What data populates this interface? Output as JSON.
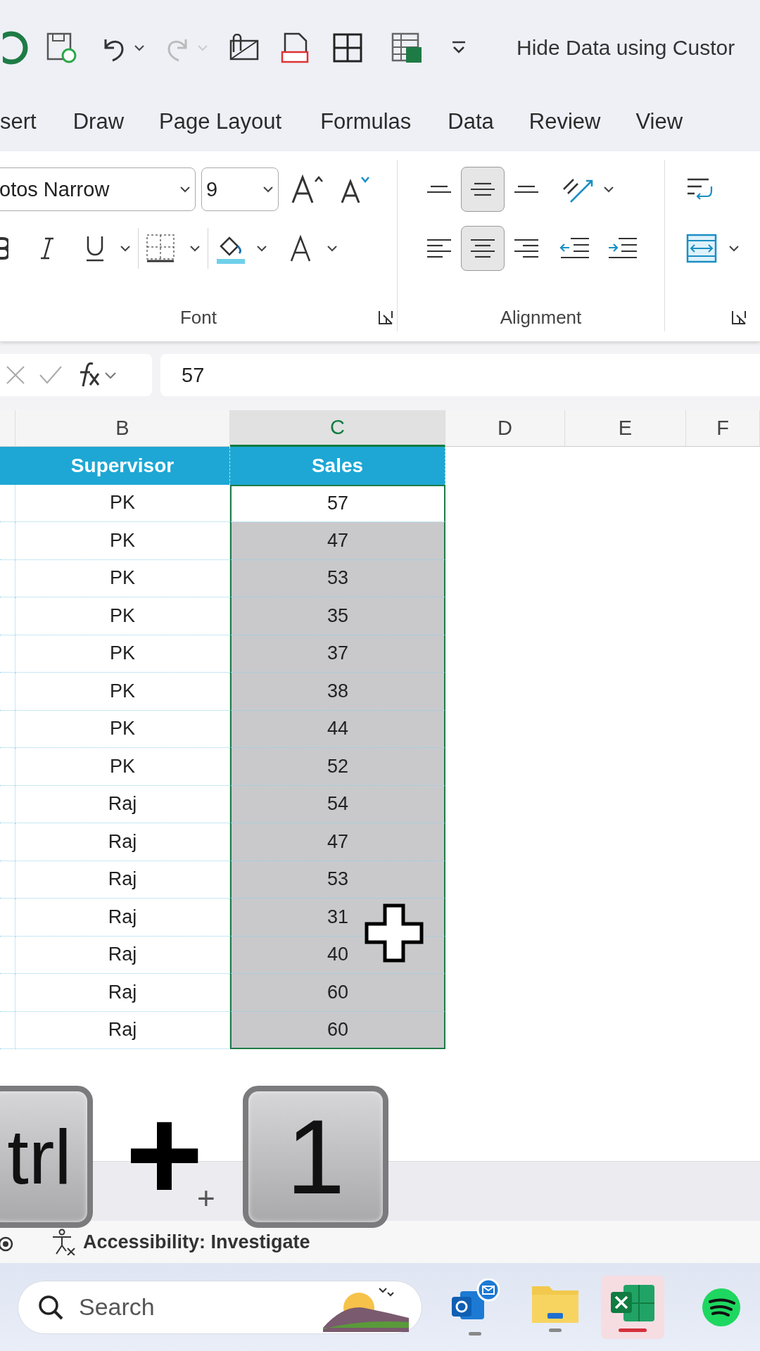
{
  "quick_access": {
    "title": "Hide Data using Custor"
  },
  "tabs": [
    {
      "label": "sert",
      "selected": false
    },
    {
      "label": "Draw",
      "selected": false
    },
    {
      "label": "Page Layout",
      "selected": false
    },
    {
      "label": "Formulas",
      "selected": false
    },
    {
      "label": "Data",
      "selected": false
    },
    {
      "label": "Review",
      "selected": false
    },
    {
      "label": "View",
      "selected": false
    }
  ],
  "ribbon": {
    "font_name": "otos Narrow",
    "font_size": "9",
    "groups": [
      "Font",
      "Alignment"
    ],
    "alignment_buttons": [
      {
        "kind": "top",
        "selected": false
      },
      {
        "kind": "middle",
        "selected": true
      },
      {
        "kind": "bottom",
        "selected": false
      },
      {
        "kind": "left",
        "selected": false
      },
      {
        "kind": "center",
        "selected": true
      },
      {
        "kind": "right",
        "selected": false
      }
    ]
  },
  "formula_bar": {
    "value": "57"
  },
  "columns": [
    {
      "label": "B",
      "selected": false
    },
    {
      "label": "C",
      "selected": true
    },
    {
      "label": "D",
      "selected": false
    },
    {
      "label": "E",
      "selected": false
    },
    {
      "label": "F",
      "selected": false
    }
  ],
  "table": {
    "headers": [
      "Supervisor",
      "Sales"
    ],
    "rows": [
      {
        "supervisor": "PK",
        "sales": "57",
        "active": true
      },
      {
        "supervisor": "PK",
        "sales": "47",
        "active": false
      },
      {
        "supervisor": "PK",
        "sales": "53",
        "active": false
      },
      {
        "supervisor": "PK",
        "sales": "35",
        "active": false
      },
      {
        "supervisor": "PK",
        "sales": "37",
        "active": false
      },
      {
        "supervisor": "PK",
        "sales": "38",
        "active": false
      },
      {
        "supervisor": "PK",
        "sales": "44",
        "active": false
      },
      {
        "supervisor": "PK",
        "sales": "52",
        "active": false
      },
      {
        "supervisor": "Raj",
        "sales": "54",
        "active": false
      },
      {
        "supervisor": "Raj",
        "sales": "47",
        "active": false
      },
      {
        "supervisor": "Raj",
        "sales": "53",
        "active": false
      },
      {
        "supervisor": "Raj",
        "sales": "31",
        "active": false
      },
      {
        "supervisor": "Raj",
        "sales": "40",
        "active": false
      },
      {
        "supervisor": "Raj",
        "sales": "60",
        "active": false
      },
      {
        "supervisor": "Raj",
        "sales": "60",
        "active": false
      }
    ]
  },
  "keys_overlay": {
    "keys": [
      "trl",
      "1"
    ],
    "plus": "+"
  },
  "sheet_bar": {
    "new_sheet": "+"
  },
  "status_bar": {
    "accessibility": "Accessibility: Investigate"
  },
  "taskbar": {
    "search_placeholder": "Search"
  }
}
